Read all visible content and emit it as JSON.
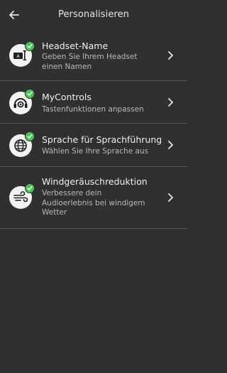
{
  "header": {
    "title": "Personalisieren",
    "back_icon": "arrow-left-icon"
  },
  "colors": {
    "background": "#2e3031",
    "badge": "#4fc25a",
    "divider": "#55585a"
  },
  "items": [
    {
      "title": "Headset-Name",
      "subtitle": "Geben Sie Ihrem Headset einen Namen",
      "icon": "headset-name-icon",
      "status": "check-badge-icon"
    },
    {
      "title": "MyControls",
      "subtitle": "Tastenfunktionen anpassen",
      "icon": "controls-gear-icon",
      "status": "check-badge-icon"
    },
    {
      "title": "Sprache für Sprachführung",
      "subtitle": "Wählen Sie Ihre Sprache aus",
      "icon": "globe-icon",
      "status": "check-badge-icon"
    },
    {
      "title": "Windgeräuschreduktion",
      "subtitle": "Verbessere dein Audioerlebnis bei windigem Wetter",
      "icon": "wind-icon",
      "status": "check-badge-icon"
    }
  ]
}
